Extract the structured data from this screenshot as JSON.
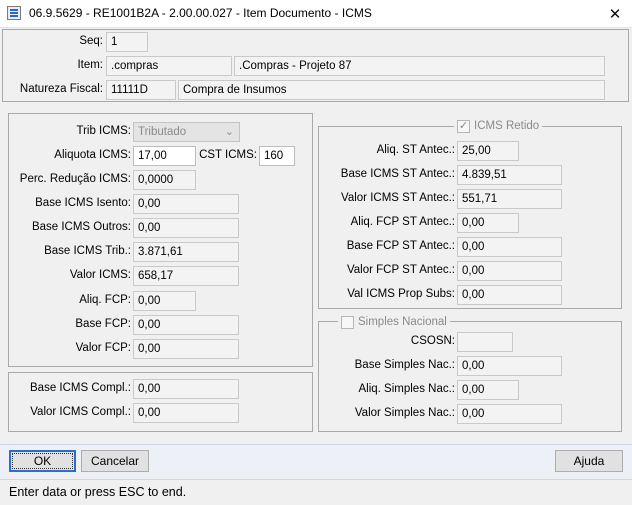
{
  "window": {
    "title": "06.9.5629 - RE1001B2A - 2.00.00.027 - Item Documento - ICMS",
    "close_glyph": "✕"
  },
  "header": {
    "seq_label": "Seq:",
    "seq_value": "1",
    "item_label": "Item:",
    "item_code": ".compras",
    "item_desc": ".Compras - Projeto 87",
    "natureza_label": "Natureza Fiscal:",
    "natureza_code": "11111D",
    "natureza_desc": "Compra de Insumos"
  },
  "icms": {
    "trib_label": "Trib ICMS:",
    "trib_value": "Tributado",
    "aliquota_label": "Aliquota ICMS:",
    "aliquota_value": "17,00",
    "cst_label": "CST ICMS:",
    "cst_value": "160",
    "perc_reducao_label": "Perc. Redução ICMS:",
    "perc_reducao_value": "0,0000",
    "base_isento_label": "Base ICMS Isento:",
    "base_isento_value": "0,00",
    "base_outros_label": "Base ICMS Outros:",
    "base_outros_value": "0,00",
    "base_trib_label": "Base ICMS Trib.:",
    "base_trib_value": "3.871,61",
    "valor_icms_label": "Valor ICMS:",
    "valor_icms_value": "658,17",
    "aliq_fcp_label": "Aliq. FCP:",
    "aliq_fcp_value": "0,00",
    "base_fcp_label": "Base FCP:",
    "base_fcp_value": "0,00",
    "valor_fcp_label": "Valor FCP:",
    "valor_fcp_value": "0,00"
  },
  "compl": {
    "base_label": "Base ICMS Compl.:",
    "base_value": "0,00",
    "valor_label": "Valor ICMS Compl.:",
    "valor_value": "0,00"
  },
  "retido": {
    "legend": "ICMS Retido",
    "checked": true,
    "aliq_st_label": "Aliq. ST Antec.:",
    "aliq_st_value": "25,00",
    "base_st_label": "Base ICMS ST Antec.:",
    "base_st_value": "4.839,51",
    "valor_st_label": "Valor ICMS ST Antec.:",
    "valor_st_value": "551,71",
    "aliq_fcp_st_label": "Aliq. FCP ST Antec.:",
    "aliq_fcp_st_value": "0,00",
    "base_fcp_st_label": "Base FCP ST Antec.:",
    "base_fcp_st_value": "0,00",
    "valor_fcp_st_label": "Valor FCP ST Antec.:",
    "valor_fcp_st_value": "0,00",
    "prop_subs_label": "Val ICMS Prop Subs:",
    "prop_subs_value": "0,00"
  },
  "simples": {
    "legend": "Simples Nacional",
    "checked": false,
    "csosn_label": "CSOSN:",
    "csosn_value": "",
    "base_label": "Base Simples Nac.:",
    "base_value": "0,00",
    "aliq_label": "Aliq. Simples Nac.:",
    "aliq_value": "0,00",
    "valor_label": "Valor Simples Nac.:",
    "valor_value": "0,00"
  },
  "buttons": {
    "ok": "OK",
    "cancel": "Cancelar",
    "help": "Ajuda"
  },
  "status": {
    "text": "Enter data or press ESC to end."
  }
}
